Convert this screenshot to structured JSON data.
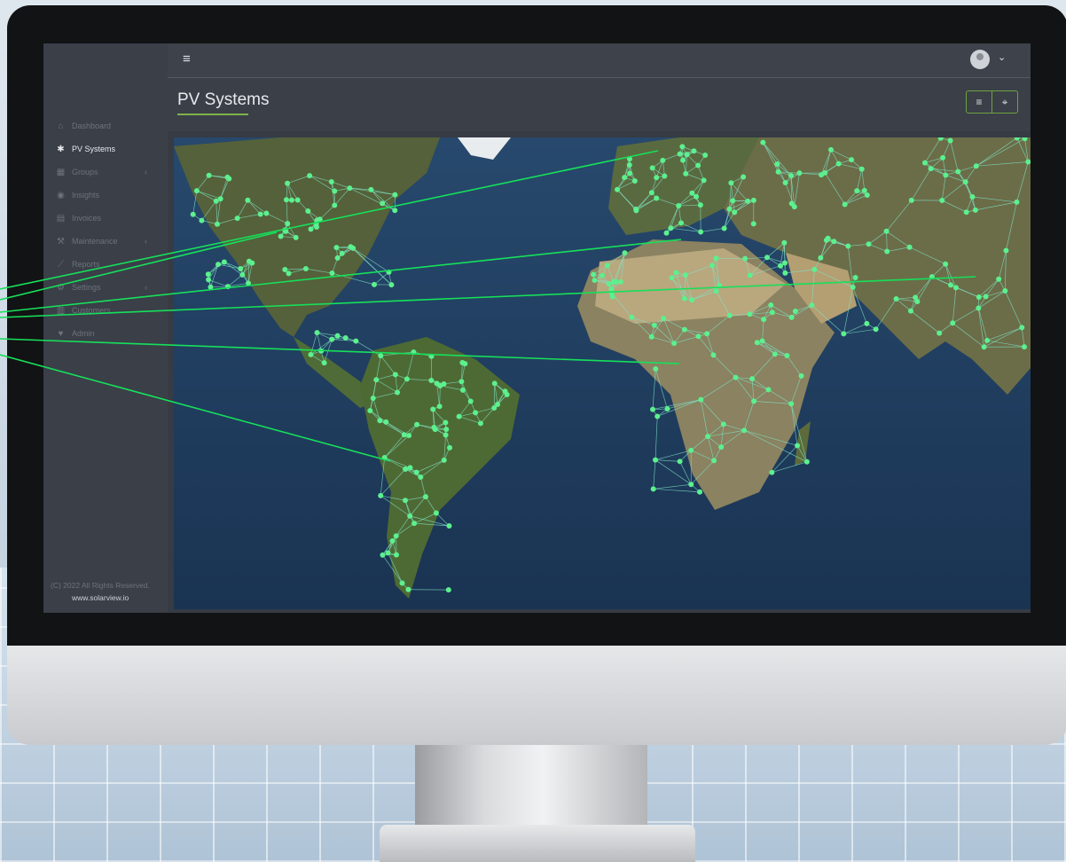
{
  "sidebar": {
    "items": [
      {
        "label": "Dashboard",
        "icon": "chart-line-icon"
      },
      {
        "label": "PV Systems",
        "icon": "solar-panel-icon",
        "active": true
      },
      {
        "label": "Groups",
        "icon": "grid-icon",
        "has_submenu": true
      },
      {
        "label": "Insights",
        "icon": "eye-icon"
      },
      {
        "label": "Invoices",
        "icon": "file-icon"
      },
      {
        "label": "Maintenance",
        "icon": "wrench-icon",
        "has_submenu": true
      },
      {
        "label": "Reports",
        "icon": "area-chart-icon"
      },
      {
        "label": "Settings",
        "icon": "gear-icon",
        "has_submenu": true
      },
      {
        "label": "Customers",
        "icon": "building-icon"
      },
      {
        "label": "Admin",
        "icon": "heart-pulse-icon"
      }
    ],
    "footer_copyright": "(C) 2022 All Rights Reserved.",
    "footer_url": "www.solarview.io"
  },
  "topbar": {
    "menu_icon": "hamburger-icon",
    "user_icon": "user-avatar-icon",
    "dropdown_icon": "chevron-down-icon"
  },
  "header": {
    "title": "PV Systems",
    "view_buttons": [
      {
        "icon": "list-icon"
      },
      {
        "icon": "map-marker-icon"
      }
    ]
  },
  "colors": {
    "accent": "#7fb24a",
    "node": "#5cf08e",
    "link": "#7fe6c8",
    "screen_bg": "#363b44"
  }
}
